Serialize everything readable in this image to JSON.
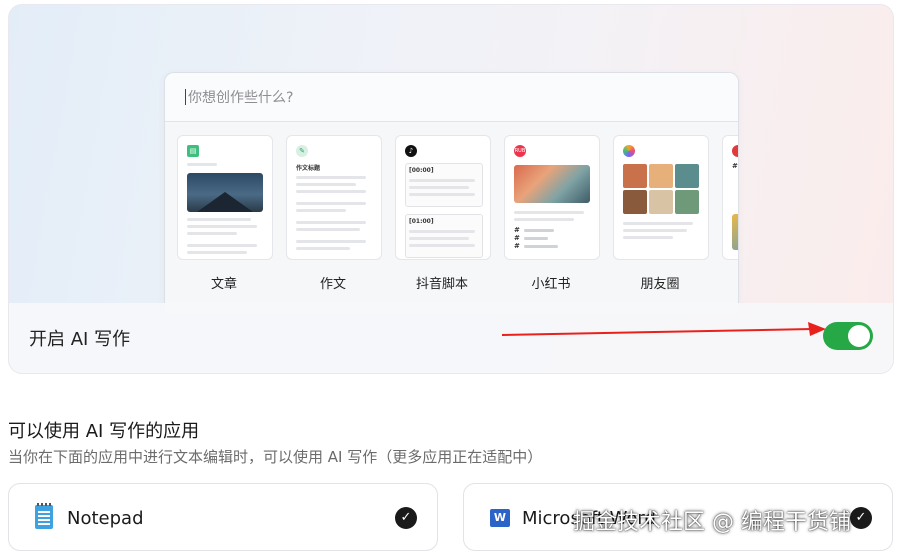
{
  "hero": {
    "prompt_placeholder": "你想创作些什么?",
    "templates": [
      {
        "label": "文章",
        "icon": "article-icon"
      },
      {
        "label": "作文",
        "icon": "pencil-icon",
        "mini_title": "作文标题"
      },
      {
        "label": "抖音脚本",
        "icon": "tiktok-icon",
        "times": [
          "[00:00]",
          "[01:00]"
        ]
      },
      {
        "label": "小红书",
        "icon": "xiaohongshu-icon",
        "badge": "RUB"
      },
      {
        "label": "朋友圈",
        "icon": "moments-icon"
      }
    ],
    "toggle_label": "开启 AI 写作",
    "toggle_on": true
  },
  "apps_section": {
    "title": "可以使用 AI 写作的应用",
    "subtitle": "当你在下面的应用中进行文本编辑时，可以使用 AI 写作（更多应用正在适配中）",
    "apps": [
      {
        "name": "Notepad",
        "icon": "notepad-icon",
        "checked": true
      },
      {
        "name": "Microsoft Word",
        "icon": "word-icon",
        "checked": true
      }
    ]
  },
  "watermark": "掘金技术社区 @ 编程干货铺",
  "colors": {
    "toggle": "#27a847",
    "arrow": "#e8211d"
  }
}
